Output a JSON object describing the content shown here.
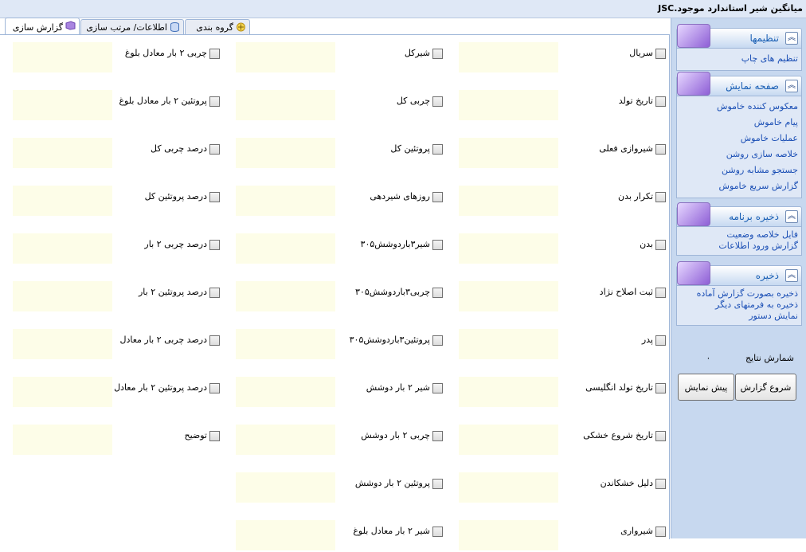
{
  "window": {
    "title": "میانگین شیر استاندارد موجود.JSC"
  },
  "tabs": [
    {
      "label": "گزارش سازی",
      "icon": "report-icon"
    },
    {
      "label": "اطلاعات/ مرتب سازی",
      "icon": "database-icon"
    },
    {
      "label": "گروه بندی",
      "icon": "grouping-icon"
    }
  ],
  "sidebar": {
    "settings": {
      "title": "تنظیمها",
      "links": [
        "تنظیم های چاپ"
      ]
    },
    "display": {
      "title": "صفحه نمایش",
      "links": [
        "معکوس کننده خاموش",
        "پیام خاموش",
        "عملیات خاموش",
        "خلاصه سازی روشن",
        "جستجو مشابه روشن",
        "گزارش سریع خاموش"
      ]
    },
    "save_program": {
      "title": "ذخیره برنامه",
      "links": [
        "فایل خلاصه وضعیت",
        "گزارش ورود اطلاعات"
      ]
    },
    "save": {
      "title": "ذخیره",
      "links": [
        "ذخیره بصورت گزارش آماده",
        "ذخیره به فرمتهای دیگر",
        "نمایش دستور"
      ]
    },
    "counter": {
      "label": "شمارش نتایج",
      "value": "۰"
    },
    "start_button": "شروع گزارش",
    "preview_button": "پیش نمایش"
  },
  "fields": {
    "right": [
      "سریال",
      "تاریخ تولد",
      "شیروازی فعلی",
      "تکرار بدن",
      "بدن",
      "ثبت اصلاح نژاد",
      "پدر",
      "تاریخ تولد انگلیسی",
      "تاریخ شروع خشکی",
      "دلیل خشکاندن",
      "شیرواری"
    ],
    "middle": [
      "شیرکل",
      "چربی کل",
      "پروتئین کل",
      "روزهای شیردهی",
      "شیر۳باردوشش۳۰۵",
      "چربی۳باردوشش۳۰۵",
      "پروتئین۳باردوشش۳۰۵",
      "شیر ۲ بار دوشش",
      "چربی ۲ بار دوشش",
      "پروتئین ۲ بار دوشش",
      "شیر ۲ بار معادل بلوغ"
    ],
    "left": [
      "چربی ۲ بار معادل بلوغ",
      "پروتئین ۲ بار معادل بلوغ",
      "درصد چربی کل",
      "درصد پروتئین کل",
      "درصد چربی ۲ بار",
      "درصد پروتئین ۲ بار",
      "درصد چربی ۲ بار معادل",
      "درصد پروتئین ۲ بار معادل",
      "توضیح"
    ]
  },
  "colors": {
    "link": "#1b4fb5",
    "panel_title": "#1a5fb4",
    "sidebar_bg": "#c7d8ef",
    "field_fill": "#fdfde8"
  }
}
